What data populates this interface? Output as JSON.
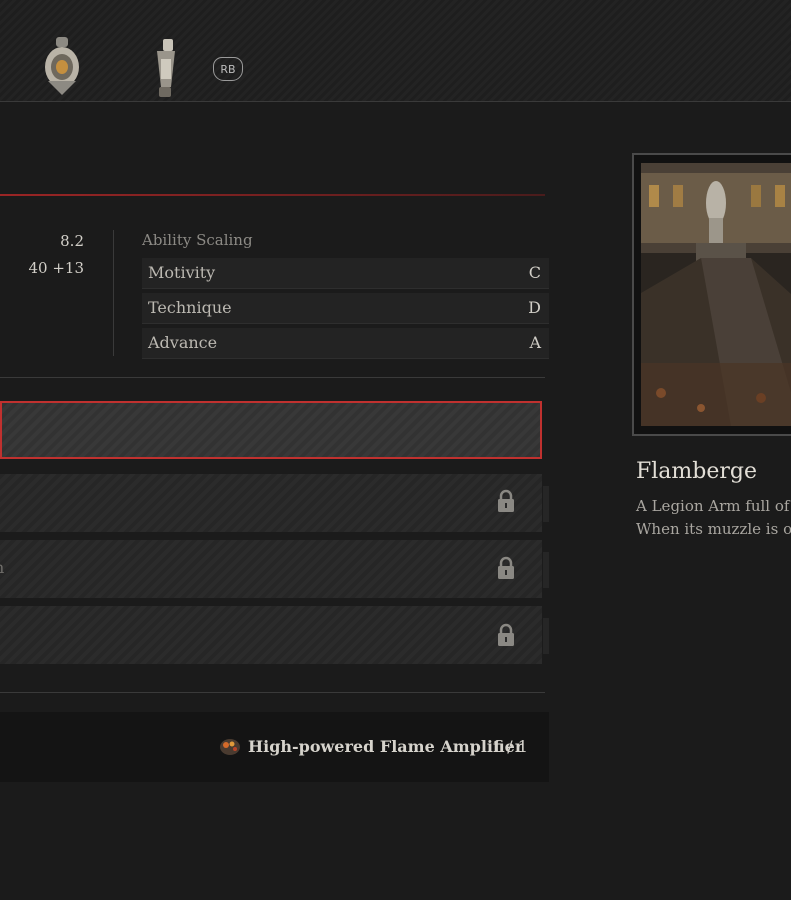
{
  "header": {
    "rb_label": "RB"
  },
  "stats": {
    "value_1": "8.2",
    "value_2": "40 +13"
  },
  "ability_scaling": {
    "title": "Ability Scaling",
    "rows": [
      {
        "label": "Motivity",
        "grade": "C"
      },
      {
        "label": "Technique",
        "grade": "D"
      },
      {
        "label": "Advance",
        "grade": "A"
      }
    ]
  },
  "slots": {
    "partial_text": "n"
  },
  "material": {
    "name": "High-powered Flame Amplifier",
    "count": "1 / 1"
  },
  "item": {
    "name": "Flamberge",
    "description_lines": [
      "A Legion Arm full of b",
      "When its muzzle is ope"
    ]
  },
  "colors": {
    "selection_border": "#c0312f",
    "background": "#1b1b1b"
  }
}
